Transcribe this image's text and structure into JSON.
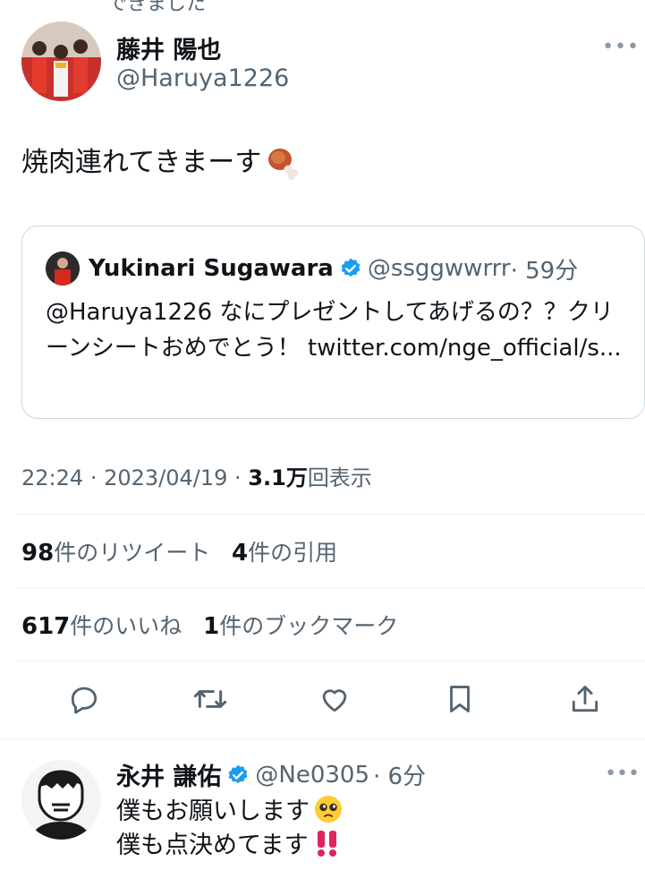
{
  "cutoff_text": "できました",
  "tweet": {
    "author_name": "藤井 陽也",
    "author_handle": "@Haruya1226",
    "text": "焼肉連れてきまーす",
    "emoji_icon": "meat-on-bone-icon"
  },
  "quote": {
    "name": "Yukinari Sugawara",
    "handle": "@ssggwwrrr",
    "time": "· 59分",
    "body": "@Haruya1226 なにプレゼントしてあげるの？？クリーンシートおめでとう！ twitter.com/nge_official/s..."
  },
  "meta": {
    "time": "22:24",
    "date": "· 2023/04/19 ·",
    "views": "3.1万",
    "views_label": "回表示"
  },
  "stats": {
    "retweets": "98",
    "retweets_label": "件のリツイート",
    "quotes": "4",
    "quotes_label": "件の引用",
    "likes": "617",
    "likes_label": "件のいいね",
    "bookmarks": "1",
    "bookmarks_label": "件のブックマーク"
  },
  "actions": [
    "reply-icon",
    "retweet-icon",
    "like-icon",
    "bookmark-icon",
    "share-icon"
  ],
  "reply": {
    "name": "永井 謙佑",
    "handle": "@Ne0305",
    "time": "· 6分",
    "line1": "僕もお願いします",
    "line2": "僕も点決めてます"
  },
  "colors": {
    "text": "#0f1419",
    "secondary": "#536471",
    "verified": "#1d9bf0",
    "border": "#cfd9de",
    "divider": "#eff3f4"
  }
}
